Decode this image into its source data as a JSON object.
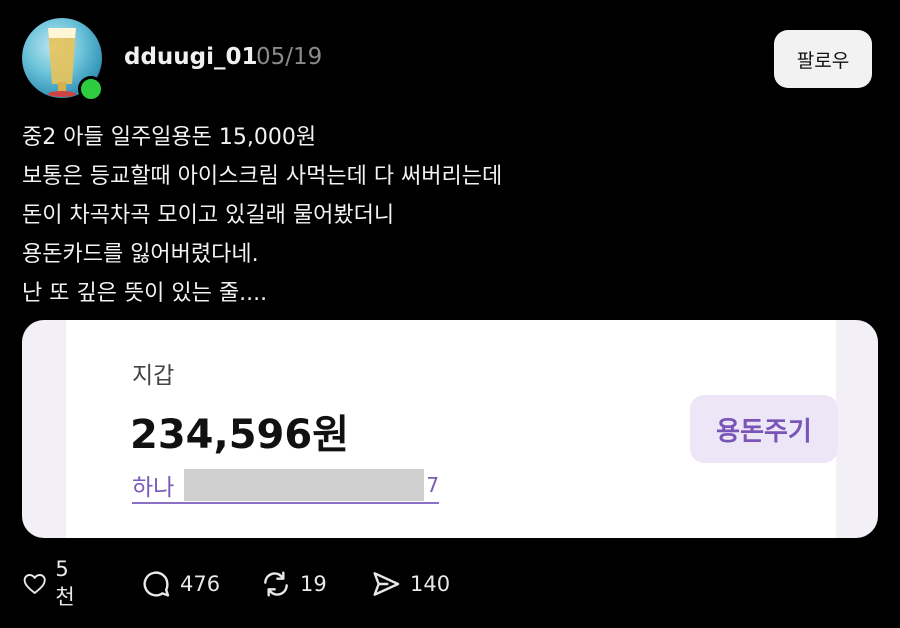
{
  "post": {
    "username": "dduugi_01",
    "date": "05/19",
    "follow_label": "팔로우",
    "lines": [
      "중2 아들 일주일용돈 15,000원",
      "보통은 등교할때 아이스크림 사먹는데 다 써버리는데",
      "돈이 차곡차곡 모이고 있길래 물어봤더니",
      "용돈카드를 잃어버렸다네.",
      "난 또 깊은 뜻이 있는 줄...."
    ]
  },
  "card": {
    "wallet_label": "지갑",
    "balance": "234,596원",
    "account_bank": "하나",
    "account_tail": "7",
    "give_button": "용돈주기"
  },
  "actions": {
    "likes": "5천",
    "comments": "476",
    "reposts": "19",
    "shares": "140"
  },
  "colors": {
    "background": "#000000",
    "online": "#2ecc40",
    "accent_purple": "#7a55b8",
    "card_bg": "#ffffff"
  },
  "icons": [
    "heart-icon",
    "comment-icon",
    "repost-icon",
    "share-icon"
  ]
}
